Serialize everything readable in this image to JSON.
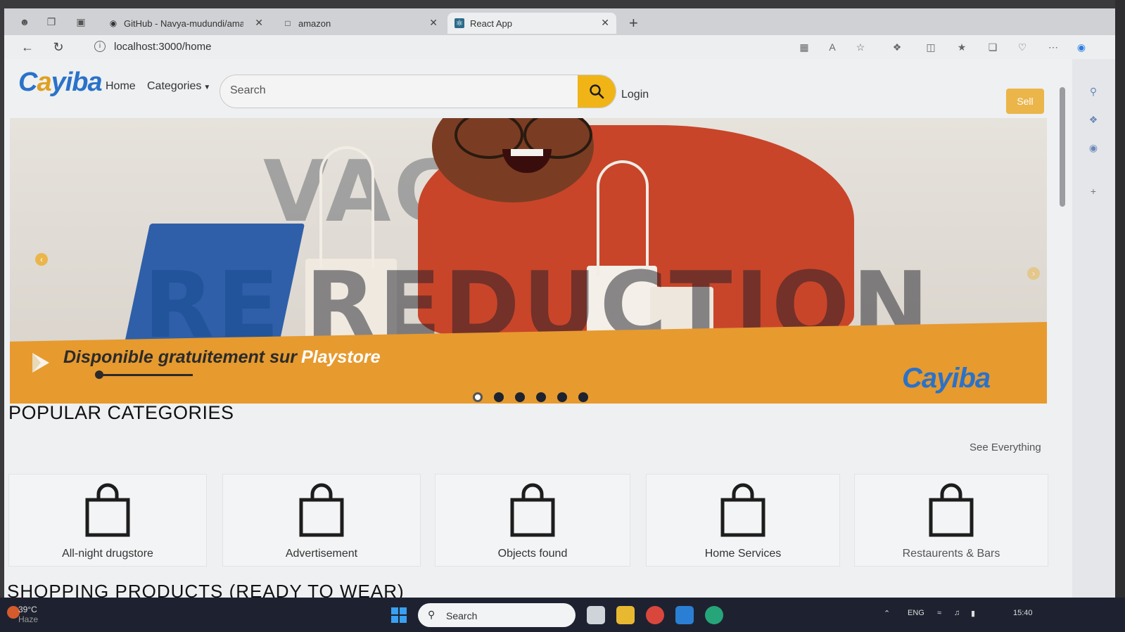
{
  "browser": {
    "tabs": [
      {
        "title": "GitHub - Navya-mudundi/amaz",
        "favicon": "github-icon"
      },
      {
        "title": "amazon",
        "favicon": "page-icon"
      },
      {
        "title": "React App",
        "favicon": "react-icon"
      }
    ],
    "url": "localhost:3000/home"
  },
  "header": {
    "logo_parts": [
      "C",
      "a",
      "yiba"
    ],
    "nav": {
      "home": "Home",
      "categories": "Categories"
    },
    "search_placeholder": "Search",
    "login": "Login",
    "sell": "Sell"
  },
  "banner": {
    "background_word_top": "VAGUE",
    "background_word_bottom": "REDUCTION",
    "promo_text": "Disponible gratuitement sur",
    "promo_store": "Playstore",
    "logo_text": "Cayiba",
    "slide_count": 6,
    "active_slide": 0
  },
  "categories": {
    "title": "POPULAR CATEGORIES",
    "see_all": "See Everything",
    "items": [
      {
        "label": "All-night drugstore",
        "icon": "shopping-bag-icon"
      },
      {
        "label": "Advertisement",
        "icon": "shopping-bag-icon"
      },
      {
        "label": "Objects found",
        "icon": "shopping-bag-icon"
      },
      {
        "label": "Home Services",
        "icon": "shopping-bag-icon"
      },
      {
        "label": "Restaurents & Bars",
        "icon": "shopping-bag-icon"
      }
    ]
  },
  "next_section_title": "SHOPPING PRODUCTS (READY TO WEAR)",
  "taskbar": {
    "temperature": "39°C",
    "weather_word": "Haze",
    "search_label": "Search",
    "language": "ENG",
    "time": "15:40"
  },
  "colors": {
    "accent": "#f0b417",
    "brand_blue": "#2a72c9",
    "banner_orange": "#e79a2e"
  }
}
